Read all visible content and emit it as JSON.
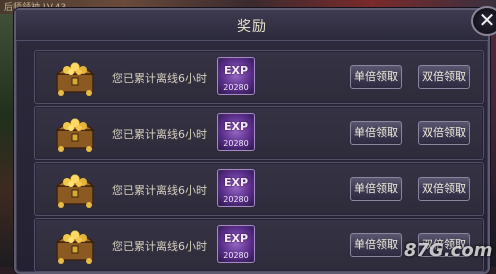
{
  "background": {
    "top_text": "后师领袖   LV.43"
  },
  "dialog": {
    "title": "奖励",
    "close_glyph": "✕"
  },
  "rows": [
    {
      "text": "您已累计离线6小时",
      "exp_label": "EXP",
      "exp_value": "20280",
      "single_label": "单倍领取",
      "double_label": "双倍领取"
    },
    {
      "text": "您已累计离线6小时",
      "exp_label": "EXP",
      "exp_value": "20280",
      "single_label": "单倍领取",
      "double_label": "双倍领取"
    },
    {
      "text": "您已累计离线6小时",
      "exp_label": "EXP",
      "exp_value": "20280",
      "single_label": "单倍领取",
      "double_label": "双倍领取"
    },
    {
      "text": "您已累计离线6小时",
      "exp_label": "EXP",
      "exp_value": "20280",
      "single_label": "单倍领取",
      "double_label": "双倍领取"
    }
  ],
  "watermark": "87G.com",
  "colors": {
    "panel_bg": "#2c2a3c",
    "row_bg": "#363344",
    "exp_purple": "#5a2e8a",
    "text_gold": "#d6d0bc"
  }
}
